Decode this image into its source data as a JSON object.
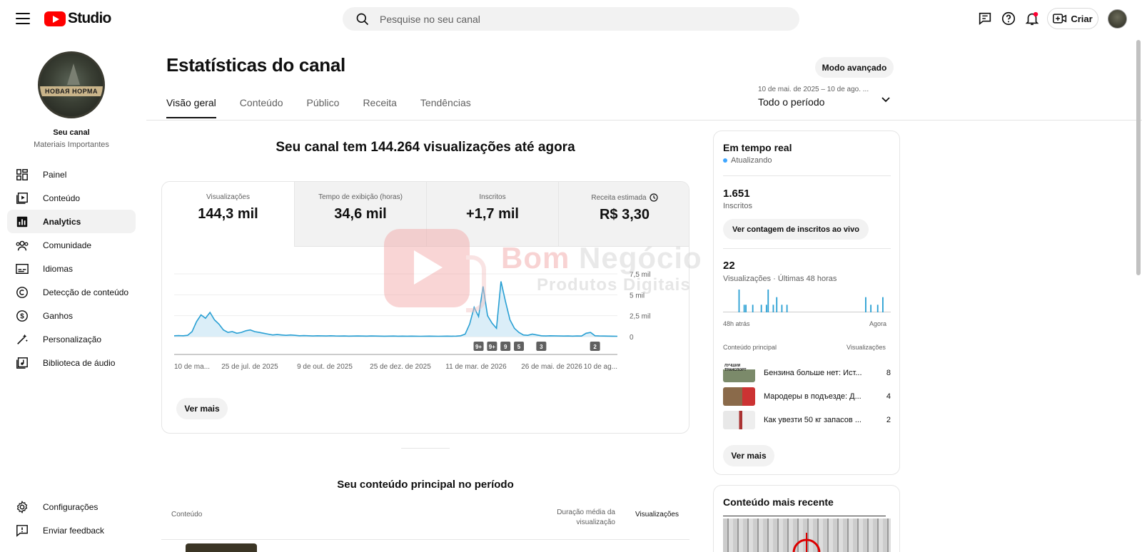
{
  "app": {
    "logo_text": "Studio",
    "search_placeholder": "Pesquise no seu canal",
    "create_label": "Criar"
  },
  "sidebar": {
    "channel_name": "Seu canal",
    "channel_subtitle": "Materiais Importantes",
    "avatar_band_text": "НОВАЯ НОРМА",
    "items": [
      {
        "label": "Painel",
        "icon": "dashboard-icon"
      },
      {
        "label": "Conteúdo",
        "icon": "content-icon"
      },
      {
        "label": "Analytics",
        "icon": "analytics-icon"
      },
      {
        "label": "Comunidade",
        "icon": "community-icon"
      },
      {
        "label": "Idiomas",
        "icon": "subtitles-icon"
      },
      {
        "label": "Detecção de conteúdo",
        "icon": "copyright-icon"
      },
      {
        "label": "Ganhos",
        "icon": "earn-icon"
      },
      {
        "label": "Personalização",
        "icon": "customization-icon"
      },
      {
        "label": "Biblioteca de áudio",
        "icon": "audio-library-icon"
      }
    ],
    "bottom_items": [
      {
        "label": "Configurações",
        "icon": "settings-icon"
      },
      {
        "label": "Enviar feedback",
        "icon": "feedback-icon"
      }
    ]
  },
  "header": {
    "title": "Estatísticas do canal",
    "advanced_mode": "Modo avançado",
    "tabs": [
      "Visão geral",
      "Conteúdo",
      "Público",
      "Receita",
      "Tendências"
    ],
    "date_range_small": "10 de mai. de 2025 – 10 de ago. ...",
    "date_range_label": "Todo o período"
  },
  "overview": {
    "headline": "Seu canal tem 144.264 visualizações até agora",
    "metrics": [
      {
        "label": "Visualizações",
        "value": "144,3 mil"
      },
      {
        "label": "Tempo de exibição (horas)",
        "value": "34,6 mil"
      },
      {
        "label": "Inscritos",
        "value": "+1,7 mil"
      },
      {
        "label": "Receita estimada",
        "value": "R$ 3,30"
      }
    ],
    "see_more": "Ver mais"
  },
  "chart_data": {
    "type": "area",
    "series": [
      {
        "values": [
          0.1,
          0.12,
          0.1,
          0.15,
          0.6,
          1.8,
          2.6,
          2.2,
          2.9,
          2.0,
          1.5,
          0.8,
          0.5,
          0.6,
          0.4,
          0.5,
          0.7,
          0.8,
          0.6,
          0.5,
          0.4,
          0.3,
          0.2,
          0.25,
          0.2,
          0.15,
          0.2,
          0.15,
          0.1,
          0.12,
          0.1,
          0.08,
          0.1,
          0.09,
          0.08,
          0.1,
          0.08,
          0.07,
          0.08,
          0.06,
          0.07,
          0.08,
          0.07,
          0.06,
          0.08,
          0.07,
          0.06,
          0.05,
          0.06,
          0.07,
          0.05,
          0.06,
          0.05,
          0.06,
          0.05,
          0.04,
          0.05,
          0.06,
          0.05,
          0.04,
          0.05,
          0.06,
          0.05,
          0.06,
          0.1,
          0.3,
          1.5,
          3.5,
          2.4,
          6.0,
          2.5,
          1.6,
          1.0,
          6.6,
          4.2,
          2.0,
          1.0,
          0.5,
          0.2,
          0.15,
          0.3,
          0.2,
          0.1,
          0.08,
          0.1,
          0.09,
          0.08,
          0.07,
          0.08,
          0.06,
          0.08,
          0.07,
          0.4,
          0.5,
          0.1,
          0.08,
          0.07,
          0.06,
          0.05,
          0.04
        ]
      }
    ],
    "x_labels": [
      "10 de ma...",
      "25 de jul. de 2025",
      "9 de out. de 2025",
      "25 de dez. de 2025",
      "11 de mar. de 2026",
      "26 de mai. de 2026",
      "10 de ag..."
    ],
    "y_ticks": [
      {
        "label": "0",
        "value": 0
      },
      {
        "label": "2,5 mil",
        "value": 2.5
      },
      {
        "label": "5 mil",
        "value": 5
      },
      {
        "label": "7,5 mil",
        "value": 7.5
      }
    ],
    "ylim": [
      0,
      7.5
    ],
    "annotations": [
      {
        "label": "9+",
        "index": 68
      },
      {
        "label": "9+",
        "index": 71
      },
      {
        "label": "9",
        "index": 74
      },
      {
        "label": "5",
        "index": 77
      },
      {
        "label": "3",
        "index": 82
      },
      {
        "label": "2",
        "index": 94
      }
    ],
    "color": "#289fd3"
  },
  "realtime": {
    "title": "Em tempo real",
    "status": "Atualizando",
    "subscribers_value": "1.651",
    "subscribers_label": "Inscritos",
    "live_count_button": "Ver contagem de inscritos ao vivo",
    "views_value": "22",
    "views_label": "Visualizações · Últimas 48 horas",
    "bars": [
      0,
      0,
      0,
      0,
      0,
      0,
      0,
      0,
      0,
      3,
      0,
      0,
      1,
      1,
      0,
      0,
      0,
      1,
      0,
      0,
      0,
      0,
      1,
      0,
      0,
      1,
      3,
      0,
      0,
      1,
      0,
      2,
      0,
      0,
      1,
      0,
      0,
      1,
      0,
      0,
      0,
      0,
      0,
      0,
      0,
      0,
      0,
      0,
      0,
      0,
      0,
      0,
      0,
      0,
      0,
      0,
      0,
      0,
      0,
      0,
      0,
      0,
      0,
      0,
      0,
      0,
      0,
      0,
      0,
      0,
      0,
      0,
      0,
      0,
      0,
      0,
      0,
      0,
      0,
      0,
      0,
      0,
      0,
      2,
      0,
      0,
      1,
      0,
      0,
      0,
      1,
      0,
      0,
      2,
      0,
      0,
      0,
      0
    ],
    "axis_left": "48h atrás",
    "axis_right": "Agora",
    "col_content": "Conteúdo principal",
    "col_views": "Visualizações",
    "top_items": [
      {
        "title": "Бензина больше нет: Ист...",
        "views": "8"
      },
      {
        "title": "Мародеры в подъезде: Д...",
        "views": "4"
      },
      {
        "title": "Как увезти 50 кг запасов ...",
        "views": "2"
      }
    ],
    "thumb_text": "ЛУЧШИЙ ТРАНСПОРТ",
    "see_more": "Ver mais",
    "bar_color": "#289fd3"
  },
  "recent": {
    "title": "Conteúdo mais recente"
  },
  "top_content": {
    "title": "Seu conteúdo principal no período",
    "col_content": "Conteúdo",
    "col_avg_duration_line1": "Duração média da",
    "col_avg_duration_line2": "visualização",
    "col_views": "Visualizações"
  },
  "watermark": {
    "line1a": "Bom",
    "line1b": "Negócio",
    "line2": "Produtos Digitais"
  }
}
